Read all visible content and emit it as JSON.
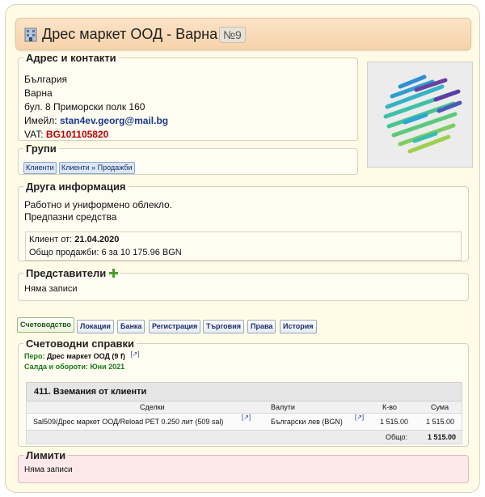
{
  "header": {
    "title": "Дрес маркет ООД - Варна",
    "number": "№9"
  },
  "address": {
    "legend": "Адрес и контакти",
    "country": "България",
    "city": "Варна",
    "street": "бул. 8 Приморски полк 160",
    "email_label": "Имейл:",
    "email": "stan4ev.georg@mail.bg",
    "vat_label": "VAT:",
    "vat": "BG101105820"
  },
  "groups": {
    "legend": "Групи",
    "tags": [
      "Клиенти",
      "Клиенти » Продажби"
    ]
  },
  "other": {
    "legend": "Друга информация",
    "line1": "Работно и униформено облекло.",
    "line2": "Предпазни средства",
    "client_since_label": "Клиент от:",
    "client_since": "21.04.2020",
    "total_sales": "Общо продажби: 6 за 10 175.96 BGN"
  },
  "reps": {
    "legend": "Представители",
    "empty": "Няма записи"
  },
  "tabs": [
    "Счетоводство",
    "Локации",
    "Банка",
    "Регистрация",
    "Търговия",
    "Права",
    "История"
  ],
  "accounting": {
    "legend": "Счетоводни справки",
    "pero_label": "Перо:",
    "pero": "Дрес маркет ООД (9 f)",
    "balances": "Салда и обороти: Юни 2021",
    "table_title": "411. Вземания от клиенти",
    "columns": [
      "Сделки",
      "Валути",
      "К-во",
      "Сума"
    ],
    "row": {
      "deal": "Sal509/Дрес маркет ООД/Reload PET 0.250 лит (509 sal)",
      "currency": "Български лев (BGN)",
      "qty": "1 515.00",
      "sum": "1 515.00"
    },
    "total_label": "Общо:",
    "total": "1 515.00"
  },
  "limits": {
    "legend": "Лимити",
    "empty": "Няма записи"
  },
  "colors": {
    "page_bg": "#fffbe6",
    "title_bg": "#f7d3ab",
    "limits_bg": "#fde9e9",
    "link": "#1a3b8a",
    "vat": "#c00000",
    "green": "#1a7a14"
  }
}
